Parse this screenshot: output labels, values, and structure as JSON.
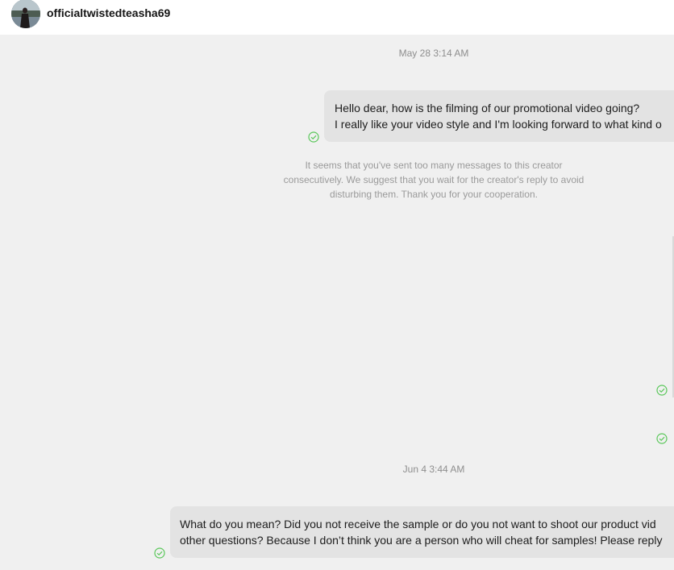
{
  "header": {
    "username": "officialtwistedteasha69"
  },
  "chat": {
    "timestamps": [
      "May 28 3:14 AM",
      "Jun 4 3:44 AM"
    ],
    "messages": [
      {
        "lines": [
          "Hello dear, how is the filming of our promotional video going?",
          "I really like your video style and I'm looking forward to what kind o"
        ]
      },
      {
        "lines": [
          "What do you mean? Did you not receive the sample or do you not want to shoot our product vid",
          "other questions? Because I don’t think you are a person who will cheat for samples! Please reply"
        ]
      }
    ],
    "notice": "It seems that you've sent too many messages to this creator consecutively. We suggest that you wait for the creator's reply to avoid disturbing them. Thank you for your cooperation."
  },
  "colors": {
    "background": "#f0f0f0",
    "header": "#ffffff",
    "bubble": "#e3e3e3",
    "sent_check": "#5ac75a"
  },
  "icons": {
    "sent_status": "check-circle-icon"
  }
}
